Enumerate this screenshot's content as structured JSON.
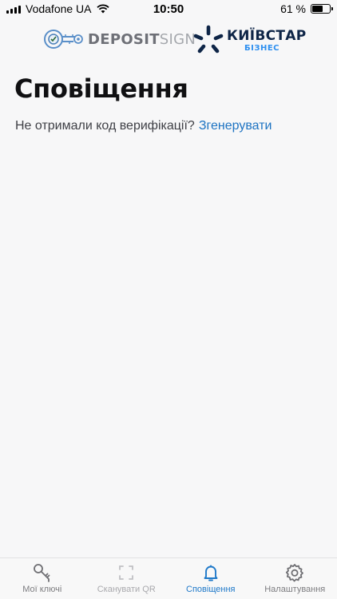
{
  "status_bar": {
    "carrier": "Vodafone UA",
    "time": "10:50",
    "battery_percent": "61 %",
    "battery_level": 0.61
  },
  "logos": {
    "deposit_bold": "DEPOSIT",
    "deposit_light": "SIGN",
    "kyivstar_name": "КИЇВСТАР",
    "kyivstar_sub": "БІЗНЕС"
  },
  "main": {
    "title": "Сповіщення",
    "verify_question": "Не отримали код верифікації?",
    "verify_link": "Згенерувати"
  },
  "tab_bar": {
    "tabs": [
      {
        "label": "Мої ключі",
        "icon": "key-icon",
        "state": "normal"
      },
      {
        "label": "Сканувати QR",
        "icon": "scan-qr-icon",
        "state": "disabled"
      },
      {
        "label": "Сповіщення",
        "icon": "bell-icon",
        "state": "active"
      },
      {
        "label": "Налаштування",
        "icon": "gear-icon",
        "state": "normal"
      }
    ]
  },
  "colors": {
    "accent": "#1f79c9",
    "link": "#1d73c2",
    "background": "#f7f7f8",
    "kyivstar_navy": "#0e2547",
    "kyivstar_blue": "#2d8ff0"
  }
}
